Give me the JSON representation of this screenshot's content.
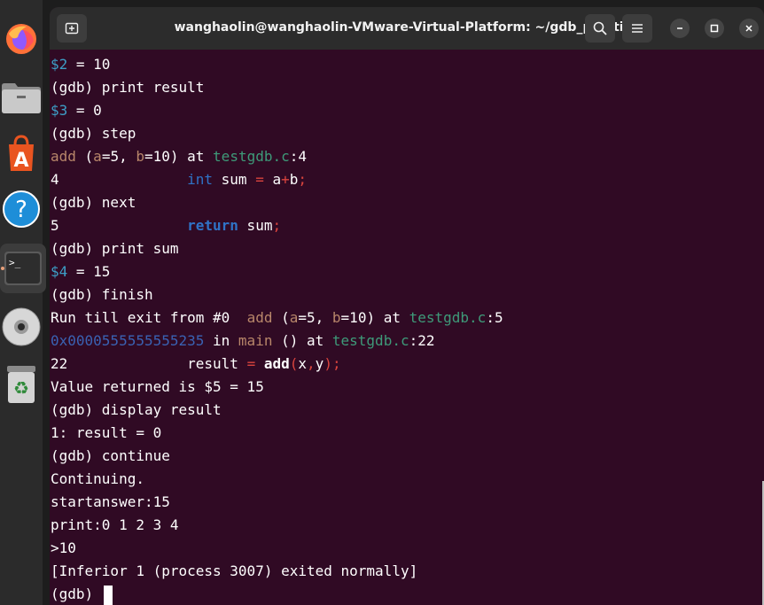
{
  "window": {
    "title": "wanghaolin@wanghaolin-VMware-Virtual-Platform: ~/gdb_practice"
  },
  "dock": {
    "items": [
      {
        "name": "firefox",
        "icon": "firefox-icon"
      },
      {
        "name": "files",
        "icon": "folder-icon"
      },
      {
        "name": "app-center",
        "icon": "app-store-icon"
      },
      {
        "name": "help",
        "icon": "help-icon"
      },
      {
        "name": "terminal",
        "icon": "terminal-icon",
        "active": true
      },
      {
        "name": "dvd",
        "icon": "disc-icon"
      },
      {
        "name": "trash",
        "icon": "trash-icon"
      }
    ]
  },
  "terminal": {
    "lines": [
      [
        [
          "$2",
          "blue"
        ],
        [
          " = 10",
          ""
        ]
      ],
      [
        [
          "(gdb) print result",
          ""
        ]
      ],
      [
        [
          "$3",
          "blue"
        ],
        [
          " = 0",
          ""
        ]
      ],
      [
        [
          "(gdb) step",
          ""
        ]
      ],
      [
        [
          "add",
          "tan"
        ],
        [
          " (",
          ""
        ],
        [
          "a",
          "tan"
        ],
        [
          "=5, ",
          ""
        ],
        [
          "b",
          "tan"
        ],
        [
          "=10) at ",
          ""
        ],
        [
          "testgdb.c",
          "green"
        ],
        [
          ":4",
          ""
        ]
      ],
      [
        [
          "4               ",
          ""
        ],
        [
          "int",
          "kw"
        ],
        [
          " sum ",
          ""
        ],
        [
          "=",
          "red"
        ],
        [
          " a",
          ""
        ],
        [
          "+",
          "red"
        ],
        [
          "b",
          ""
        ],
        [
          ";",
          "red"
        ]
      ],
      [
        [
          "(gdb) next",
          ""
        ]
      ],
      [
        [
          "5               ",
          ""
        ],
        [
          "return",
          "kwb"
        ],
        [
          " sum",
          ""
        ],
        [
          ";",
          "red"
        ]
      ],
      [
        [
          "(gdb) print sum",
          ""
        ]
      ],
      [
        [
          "$4",
          "blue"
        ],
        [
          " = 15",
          ""
        ]
      ],
      [
        [
          "(gdb) finish",
          ""
        ]
      ],
      [
        [
          "Run till exit from #0  ",
          ""
        ],
        [
          "add",
          "tan"
        ],
        [
          " (",
          ""
        ],
        [
          "a",
          "tan"
        ],
        [
          "=5, ",
          ""
        ],
        [
          "b",
          "tan"
        ],
        [
          "=10) at ",
          ""
        ],
        [
          "testgdb.c",
          "green"
        ],
        [
          ":5",
          ""
        ]
      ],
      [
        [
          "0x0000555555555235",
          "addr"
        ],
        [
          " in ",
          ""
        ],
        [
          "main",
          "tan"
        ],
        [
          " () at ",
          ""
        ],
        [
          "testgdb.c",
          "green"
        ],
        [
          ":22",
          ""
        ]
      ],
      [
        [
          "22              result ",
          ""
        ],
        [
          "=",
          "red"
        ],
        [
          " ",
          ""
        ],
        [
          "add",
          "bold"
        ],
        [
          "(",
          "red"
        ],
        [
          "x",
          ""
        ],
        [
          ",",
          "red"
        ],
        [
          "y",
          ""
        ],
        [
          ");",
          "red"
        ]
      ],
      [
        [
          "Value returned is $5 = 15",
          ""
        ]
      ],
      [
        [
          "(gdb) display result",
          ""
        ]
      ],
      [
        [
          "1: result = 0",
          ""
        ]
      ],
      [
        [
          "(gdb) continue",
          ""
        ]
      ],
      [
        [
          "Continuing.",
          ""
        ]
      ],
      [
        [
          "startanswer:15",
          ""
        ]
      ],
      [
        [
          "print:0 1 2 3 4",
          ""
        ]
      ],
      [
        [
          ">10",
          ""
        ]
      ],
      [
        [
          "[Inferior 1 (process 3007) exited normally]",
          ""
        ]
      ],
      [
        [
          "(gdb) ",
          ""
        ]
      ]
    ]
  },
  "colors": {
    "terminal_bg": "#300a24",
    "titlebar_bg": "#2c2c2c",
    "dock_bg": "#2b2b2b"
  }
}
